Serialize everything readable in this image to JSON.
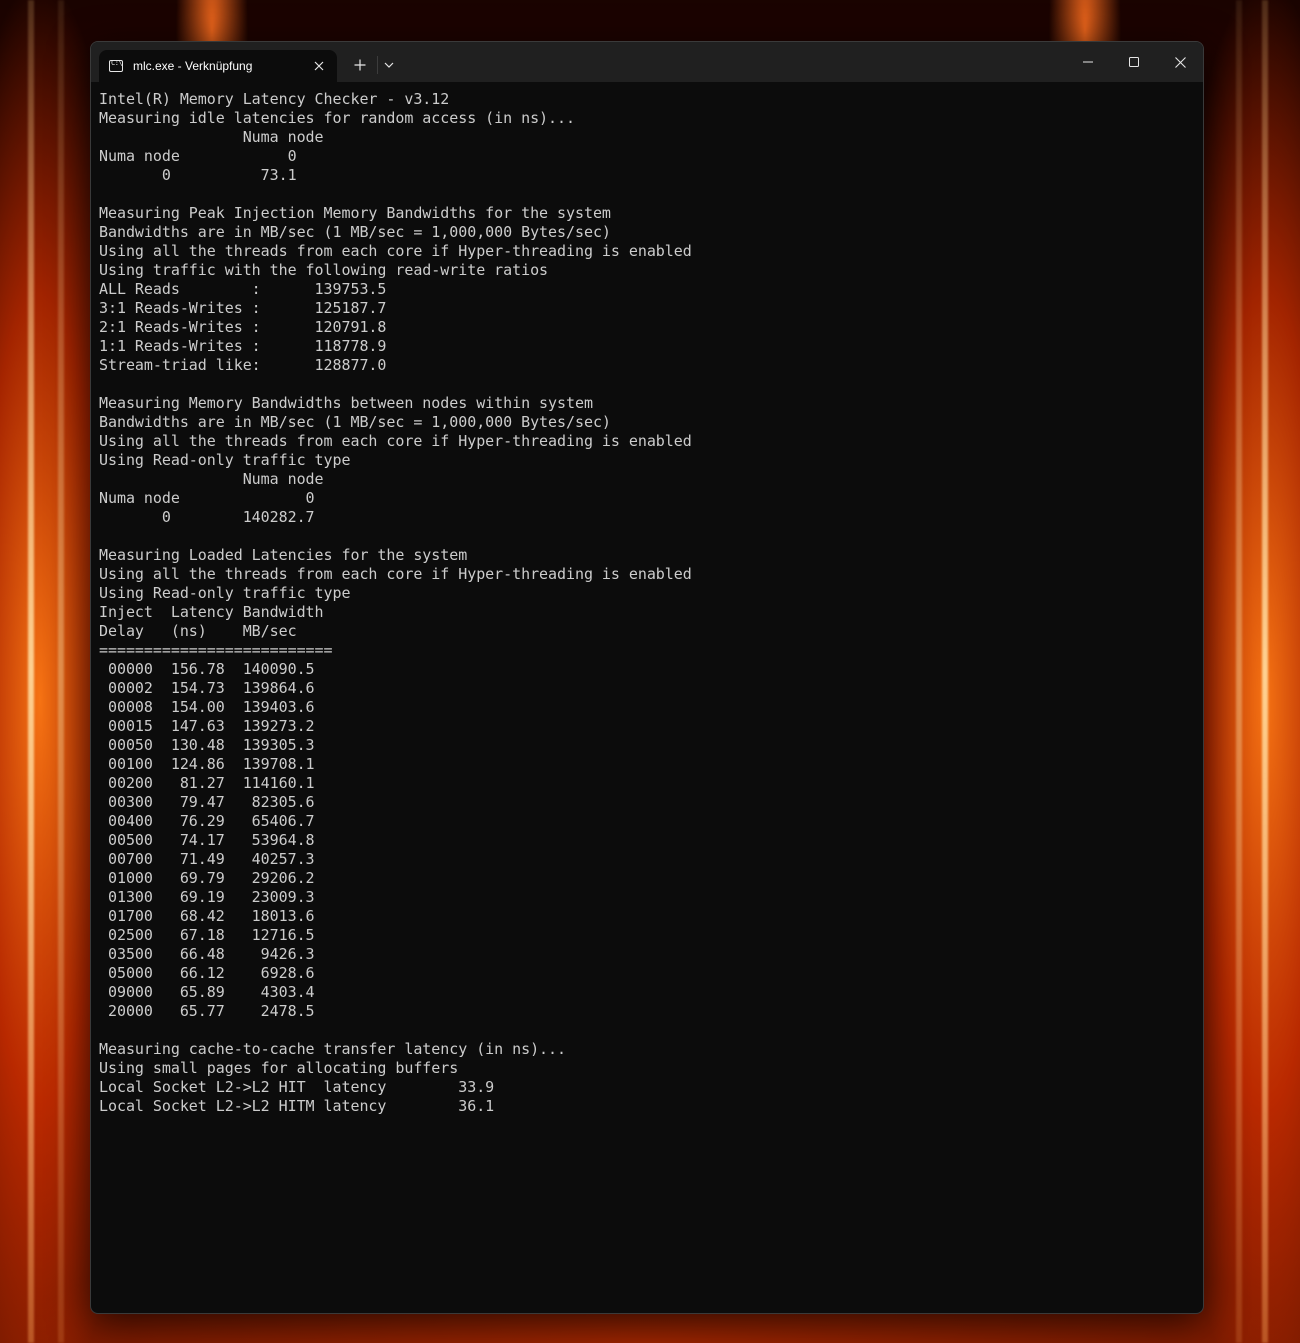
{
  "window": {
    "tab_title": "mlc.exe - Verknüpfung",
    "tab_icon_glyph": "C:\\",
    "icons": {
      "tab_icon": "terminal-icon",
      "tab_close": "close-icon",
      "new_tab": "plus-icon",
      "dropdown": "chevron-down-icon",
      "minimize": "minimize-icon",
      "maximize": "maximize-icon",
      "close": "close-icon"
    }
  },
  "terminal": {
    "lines": [
      "Intel(R) Memory Latency Checker - v3.12",
      "Measuring idle latencies for random access (in ns)...",
      "                Numa node",
      "Numa node            0",
      "       0          73.1",
      "",
      "Measuring Peak Injection Memory Bandwidths for the system",
      "Bandwidths are in MB/sec (1 MB/sec = 1,000,000 Bytes/sec)",
      "Using all the threads from each core if Hyper-threading is enabled",
      "Using traffic with the following read-write ratios",
      "ALL Reads        :      139753.5",
      "3:1 Reads-Writes :      125187.7",
      "2:1 Reads-Writes :      120791.8",
      "1:1 Reads-Writes :      118778.9",
      "Stream-triad like:      128877.0",
      "",
      "Measuring Memory Bandwidths between nodes within system",
      "Bandwidths are in MB/sec (1 MB/sec = 1,000,000 Bytes/sec)",
      "Using all the threads from each core if Hyper-threading is enabled",
      "Using Read-only traffic type",
      "                Numa node",
      "Numa node              0",
      "       0        140282.7",
      "",
      "Measuring Loaded Latencies for the system",
      "Using all the threads from each core if Hyper-threading is enabled",
      "Using Read-only traffic type",
      "Inject  Latency Bandwidth",
      "Delay   (ns)    MB/sec",
      "==========================",
      " 00000  156.78  140090.5",
      " 00002  154.73  139864.6",
      " 00008  154.00  139403.6",
      " 00015  147.63  139273.2",
      " 00050  130.48  139305.3",
      " 00100  124.86  139708.1",
      " 00200   81.27  114160.1",
      " 00300   79.47   82305.6",
      " 00400   76.29   65406.7",
      " 00500   74.17   53964.8",
      " 00700   71.49   40257.3",
      " 01000   69.79   29206.2",
      " 01300   69.19   23009.3",
      " 01700   68.42   18013.6",
      " 02500   67.18   12716.5",
      " 03500   66.48    9426.3",
      " 05000   66.12    6928.6",
      " 09000   65.89    4303.4",
      " 20000   65.77    2478.5",
      "",
      "Measuring cache-to-cache transfer latency (in ns)...",
      "Using small pages for allocating buffers",
      "Local Socket L2->L2 HIT  latency        33.9",
      "Local Socket L2->L2 HITM latency        36.1"
    ]
  }
}
